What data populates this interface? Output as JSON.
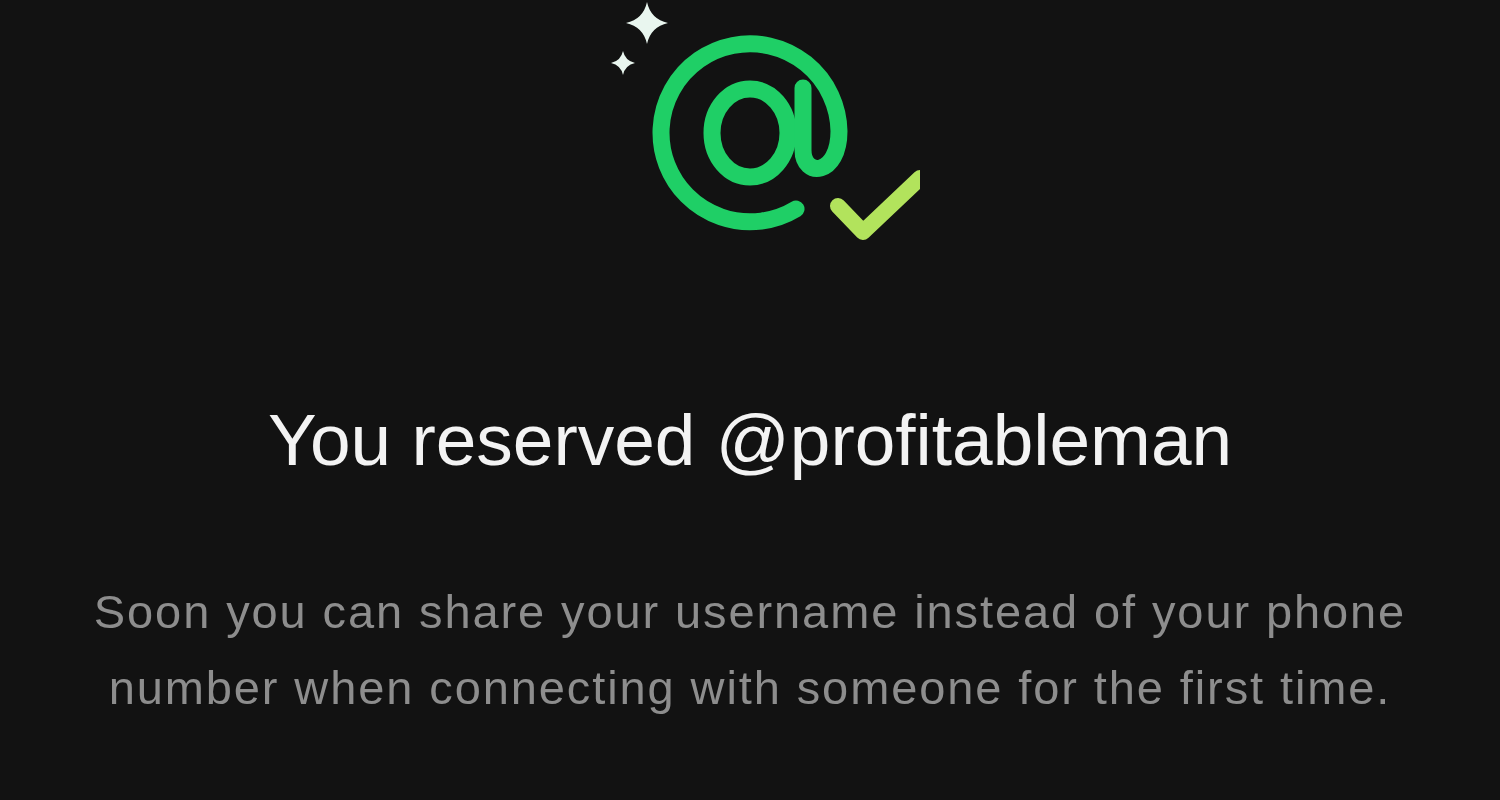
{
  "title": "You reserved @profitableman",
  "description": "Soon you can share your username instead of your phone number when connecting with someone for the first time."
}
